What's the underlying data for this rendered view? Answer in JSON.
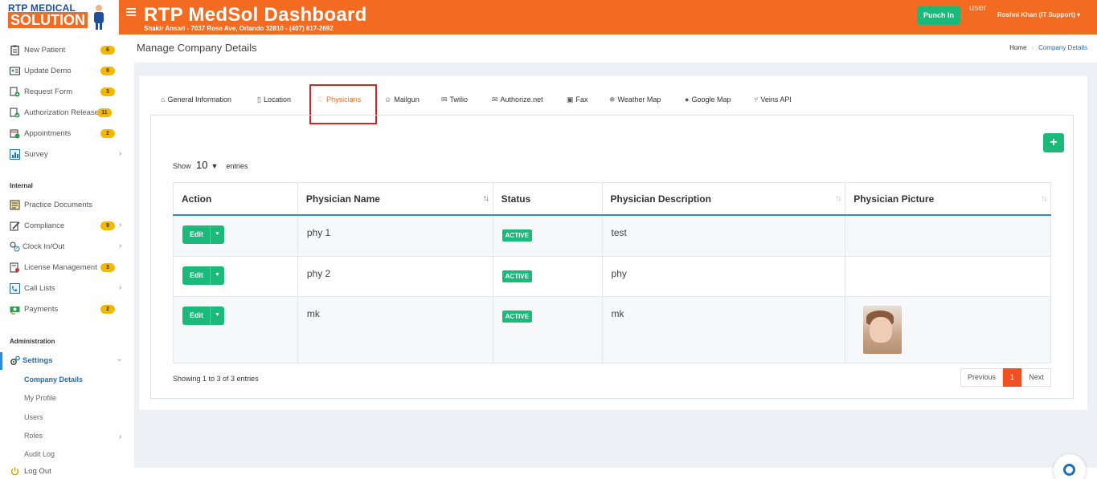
{
  "header": {
    "logo_line1": "RTP MEDICAL",
    "logo_line2": "SOLUTION",
    "title": "RTP MedSol Dashboard",
    "subtitle": "Shakir Ansari - 7037 Rose Ave, Orlando 32810 - (407) 617-2692",
    "punch_in_label": "Punch In",
    "user_img_alt": "user",
    "user_name": "Roshni Khan (IT Support)"
  },
  "sidebar": {
    "items": [
      {
        "label": "New Patient",
        "badge": "6"
      },
      {
        "label": "Update Demo",
        "badge": "9"
      },
      {
        "label": "Request Form",
        "badge": "3"
      },
      {
        "label": "Authorization Release",
        "badge": "11"
      },
      {
        "label": "Appointments",
        "badge": "2"
      },
      {
        "label": "Survey"
      }
    ],
    "internal_title": "Internal",
    "internal_items": [
      {
        "label": "Practice Documents"
      },
      {
        "label": "Compliance",
        "badge": "9"
      },
      {
        "label": "Clock In/Out"
      },
      {
        "label": "License Management",
        "badge": "3"
      },
      {
        "label": "Call Lists"
      },
      {
        "label": "Payments",
        "badge": "2"
      }
    ],
    "admin_title": "Administration",
    "settings_label": "Settings",
    "settings_sub": [
      "Company Details",
      "My Profile",
      "Users",
      "Roles",
      "Audit Log"
    ],
    "logout_label": "Log Out"
  },
  "page": {
    "heading": "Manage Company Details",
    "breadcrumb_home": "Home",
    "breadcrumb_current": "Company Details"
  },
  "tabs": [
    {
      "label": "General Information"
    },
    {
      "label": "Location"
    },
    {
      "label": "Physicians"
    },
    {
      "label": "Mailgun"
    },
    {
      "label": "Twilio"
    },
    {
      "label": "Authorize.net"
    },
    {
      "label": "Fax"
    },
    {
      "label": "Weather Map"
    },
    {
      "label": "Google Map"
    },
    {
      "label": "Veins API"
    }
  ],
  "table": {
    "show_label": "Show",
    "entries_value": "10",
    "entries_label": "entries",
    "columns": [
      "Action",
      "Physician Name",
      "Status",
      "Physician Description",
      "Physician Picture"
    ],
    "edit_label": "Edit",
    "rows": [
      {
        "name": "phy 1",
        "status": "ACTIVE",
        "description": "test",
        "has_picture": false
      },
      {
        "name": "phy 2",
        "status": "ACTIVE",
        "description": "phy",
        "has_picture": false
      },
      {
        "name": "mk",
        "status": "ACTIVE",
        "description": "mk",
        "has_picture": true
      }
    ],
    "footer_info": "Showing 1 to 3 of 3 entries",
    "prev_label": "Previous",
    "page_current": "1",
    "next_label": "Next"
  },
  "colors": {
    "brand_orange": "#f26b21",
    "success_green": "#1bb97a",
    "badge_yellow": "#f5b800",
    "link_blue": "#1f6fb2",
    "highlight_red": "#e02020"
  }
}
